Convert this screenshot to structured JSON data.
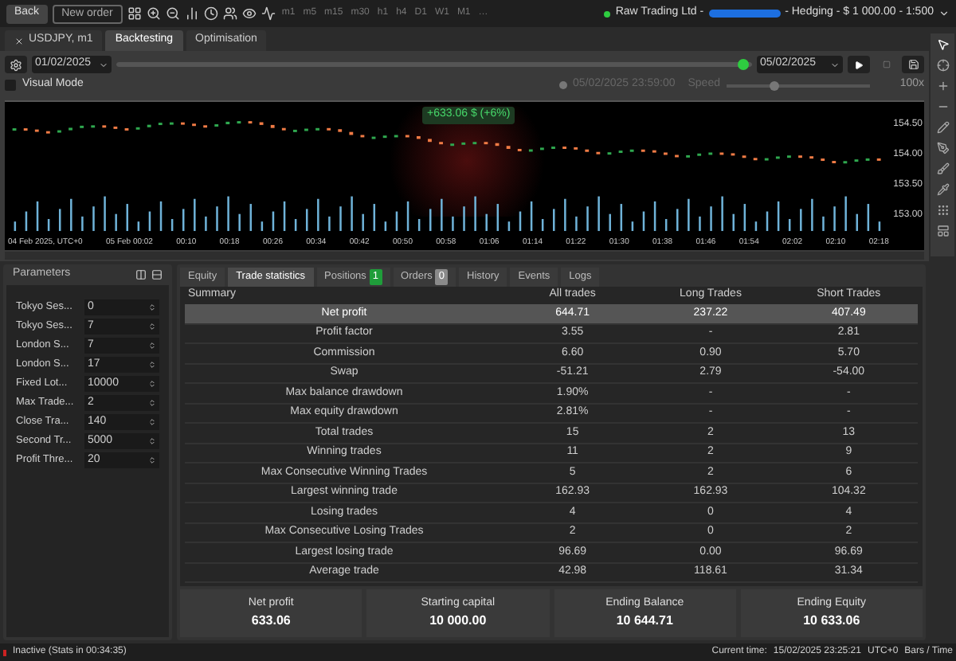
{
  "top_bar": {
    "buttons": [
      "Back",
      "New order"
    ],
    "timeframes": [
      "m1",
      "m5",
      "m15",
      "m30",
      "h1",
      "h4",
      "D1",
      "W1",
      "M1",
      "…"
    ],
    "account": {
      "connected": true,
      "broker": "Raw Trading Ltd - ",
      "details": " - Hedging - $ 1 000.00 - 1:500"
    }
  },
  "tabs": [
    {
      "label": "USDJPY, m1",
      "selected": false,
      "closable": true
    },
    {
      "label": "Backtesting",
      "selected": true,
      "closable": false
    },
    {
      "label": "Optimisation",
      "selected": false,
      "closable": false
    }
  ],
  "controls": {
    "start_date": "01/02/2025",
    "end_date": "05/02/2025",
    "progress": {
      "level": 1
    },
    "visual_mode": {
      "label": "Visual Mode",
      "checked": false
    },
    "current": "05/02/2025 23:59:00",
    "speed_label": "Speed",
    "speed": {
      "level": 0.3
    },
    "speed_value": "100x"
  },
  "chart": {
    "badge": "+633.06 $ (+6%)",
    "price_labels": [
      "154.50",
      "154.00",
      "153.50",
      "153.00"
    ],
    "time_labels": [
      "04 Feb 2025, UTC+0",
      "05 Feb 00:02",
      "00:10",
      "00:18",
      "00:26",
      "00:34",
      "00:42",
      "00:50",
      "00:58",
      "01:06",
      "01:14",
      "01:22",
      "01:30",
      "01:38",
      "01:46",
      "01:54",
      "02:02",
      "02:10",
      "02:18"
    ]
  },
  "parameters": {
    "title": "Parameters",
    "items": [
      {
        "label": "Tokyo Ses...",
        "value": "0"
      },
      {
        "label": "Tokyo Ses...",
        "value": "7"
      },
      {
        "label": "London S...",
        "value": "7"
      },
      {
        "label": "London S...",
        "value": "17"
      },
      {
        "label": "Fixed Lot...",
        "value": "10000"
      },
      {
        "label": "Max Trade...",
        "value": "2"
      },
      {
        "label": "Close Tra...",
        "value": "140"
      },
      {
        "label": "Second Tr...",
        "value": "5000"
      },
      {
        "label": "Profit Thre...",
        "value": "20"
      }
    ]
  },
  "result_tabs": [
    {
      "label": "Equity",
      "selected": false
    },
    {
      "label": "Trade statistics",
      "selected": true
    },
    {
      "label": "Positions",
      "selected": false,
      "count": "1",
      "color": "#1f9d3a"
    },
    {
      "label": "Orders",
      "selected": false,
      "count": "0",
      "color": "#8a8a8a"
    },
    {
      "label": "History",
      "selected": false
    },
    {
      "label": "Events",
      "selected": false
    },
    {
      "label": "Logs",
      "selected": false
    }
  ],
  "table": {
    "columns": [
      "Summary",
      "All trades",
      "Long Trades",
      "Short Trades"
    ],
    "rows": [
      {
        "name": "Net profit",
        "all": "644.71",
        "long": "237.22",
        "short": "407.49",
        "selected": true
      },
      {
        "name": "Profit factor",
        "all": "3.55",
        "long": "-",
        "short": "2.81",
        "selected": false
      },
      {
        "name": "Commission",
        "all": "6.60",
        "long": "0.90",
        "short": "5.70",
        "selected": false
      },
      {
        "name": "Swap",
        "all": "-51.21",
        "long": "2.79",
        "short": "-54.00",
        "selected": false
      },
      {
        "name": "Max balance drawdown",
        "all": "1.90%",
        "long": "-",
        "short": "-",
        "selected": false
      },
      {
        "name": "Max equity drawdown",
        "all": "2.81%",
        "long": "-",
        "short": "-",
        "selected": false
      },
      {
        "name": "Total trades",
        "all": "15",
        "long": "2",
        "short": "13",
        "selected": false
      },
      {
        "name": "Winning trades",
        "all": "11",
        "long": "2",
        "short": "9",
        "selected": false
      },
      {
        "name": "Max Consecutive Winning Trades",
        "all": "5",
        "long": "2",
        "short": "6",
        "selected": false
      },
      {
        "name": "Largest winning trade",
        "all": "162.93",
        "long": "162.93",
        "short": "104.32",
        "selected": false
      },
      {
        "name": "Losing trades",
        "all": "4",
        "long": "0",
        "short": "4",
        "selected": false
      },
      {
        "name": "Max Consecutive Losing Trades",
        "all": "2",
        "long": "0",
        "short": "2",
        "selected": false
      },
      {
        "name": "Largest losing trade",
        "all": "96.69",
        "long": "0.00",
        "short": "96.69",
        "selected": false
      },
      {
        "name": "Average trade",
        "all": "42.98",
        "long": "118.61",
        "short": "31.34",
        "selected": false
      }
    ]
  },
  "summary_cards": [
    {
      "label": "Net profit",
      "value": "633.06"
    },
    {
      "label": "Starting capital",
      "value": "10 000.00"
    },
    {
      "label": "Ending Balance",
      "value": "10 644.71"
    },
    {
      "label": "Ending Equity",
      "value": "10 633.06"
    }
  ],
  "status_bar": {
    "state": "Inactive (Stats in 00:34:35)",
    "current_time_label": "Current time:",
    "current_time": "15/02/2025 23:25:21",
    "timezone": "UTC+0",
    "bars": "Bars / Time"
  }
}
